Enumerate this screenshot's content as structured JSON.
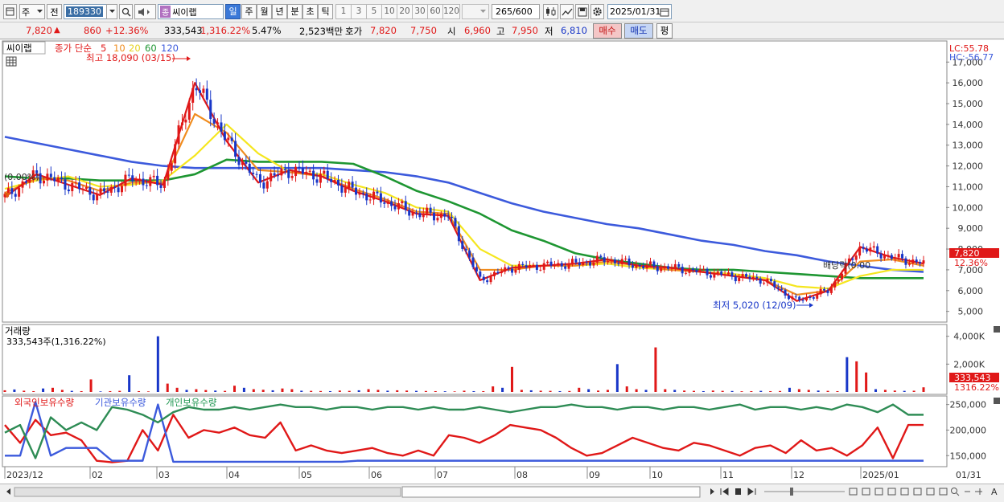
{
  "toolbar": {
    "market_label": "주",
    "prev_label": "전",
    "stock_code": "189330",
    "stock_name": "씨이랩",
    "stock_tag": "종",
    "periods": [
      "일",
      "주",
      "월",
      "년",
      "분",
      "초",
      "틱"
    ],
    "intervals": [
      "1",
      "3",
      "5",
      "10",
      "20",
      "30",
      "60",
      "120"
    ],
    "count": "265/600",
    "date": "2025/01/31"
  },
  "quote": {
    "price": "7,820",
    "change": "860",
    "change_pct": "+12.36%",
    "volume": "333,543",
    "volume_ratio": "1,316.22%",
    "turnover_pct": "5.47%",
    "amount": "2,523백만",
    "bid_label": "호가",
    "bid": "7,820",
    "ask": "7,750",
    "open_label": "시",
    "open": "6,960",
    "high_label": "고",
    "high": "7,950",
    "low_label": "저",
    "low": "6,810",
    "buy_label": "매수",
    "sell_label": "매도",
    "flat_label": "평"
  },
  "price_panel": {
    "stock_name": "씨이랩",
    "ma_legend": {
      "label": "종가 단순",
      "periods": [
        "5",
        "10",
        "20",
        "60",
        "120"
      ]
    },
    "high_note": "최고 18,090 (03/15)",
    "low_note": "최저 5,020 (12/09)",
    "left_note": "(0.00%)",
    "dividend_note": "배당락(0.00",
    "lc": "LC:55.78",
    "hc": "HC:-56.77",
    "last_price": "7,820",
    "last_pct": "12.36%",
    "y_ticks": [
      "17,000",
      "16,000",
      "15,000",
      "14,000",
      "13,000",
      "12,000",
      "11,000",
      "10,000",
      "9,000",
      "8,000",
      "7,000",
      "6,000",
      "5,000"
    ]
  },
  "volume_panel": {
    "title": "거래량",
    "info": "333,543주(1,316.22%)",
    "y_ticks": [
      "4,000K",
      "2,000K"
    ],
    "last_volume": "333,543",
    "last_ratio": "1316.22%"
  },
  "holding_panel": {
    "series": [
      "외국인보유수량",
      "기관보유수량",
      "개인보유수량"
    ],
    "y_ticks": [
      "250,000",
      "200,000",
      "150,000"
    ]
  },
  "x_axis": {
    "labels": [
      "2023/12",
      "02",
      "03",
      "04",
      "05",
      "06",
      "07",
      "08",
      "09",
      "10",
      "11",
      "12",
      "2025/01",
      "01/31"
    ]
  },
  "colors": {
    "ma5": "#e01818",
    "ma10": "#f08c1e",
    "ma20": "#f5e61e",
    "ma60": "#1e9632",
    "ma120": "#3c5adc",
    "up": "#e01818",
    "down": "#1836c8"
  },
  "chart_data": [
    {
      "type": "line",
      "title": "씨이랩",
      "y_unit": "KRW",
      "ylim": [
        4600,
        17900
      ],
      "x": [
        "2023/12",
        "02",
        "03",
        "04",
        "05",
        "06",
        "07",
        "08",
        "09",
        "10",
        "11",
        "12",
        "2025/01",
        "01/31"
      ],
      "series": [
        {
          "name": "5",
          "values": [
            10500,
            11600,
            11100,
            10600,
            11400,
            11100,
            16000,
            13200,
            11200,
            11800,
            11500,
            10800,
            10300,
            9700,
            9600,
            6500,
            7100,
            7200,
            7300,
            7500,
            7200,
            7100,
            6900,
            6700,
            6500,
            5500,
            6000,
            8100,
            7600,
            7300
          ]
        },
        {
          "name": "10",
          "values": [
            10700,
            11400,
            11300,
            10800,
            11200,
            11200,
            14500,
            13600,
            11800,
            11700,
            11500,
            10900,
            10400,
            9800,
            9700,
            7000,
            7000,
            7200,
            7200,
            7400,
            7200,
            7000,
            6900,
            6700,
            6500,
            5800,
            6000,
            7400,
            7500,
            7200
          ]
        },
        {
          "name": "20",
          "values": [
            10900,
            11300,
            11500,
            11000,
            11100,
            11300,
            12500,
            14000,
            12600,
            11700,
            11600,
            11100,
            10700,
            10000,
            9800,
            8000,
            7200,
            7200,
            7200,
            7300,
            7100,
            7000,
            6900,
            6800,
            6600,
            6200,
            6100,
            6700,
            7000,
            7000
          ]
        },
        {
          "name": "60",
          "values": [
            11500,
            11400,
            11400,
            11300,
            11300,
            11300,
            11600,
            12300,
            12200,
            12200,
            12200,
            12100,
            11500,
            10800,
            10300,
            9700,
            8900,
            8400,
            7800,
            7500,
            7300,
            7100,
            7000,
            7000,
            6900,
            6800,
            6700,
            6600,
            6600,
            6600
          ]
        },
        {
          "name": "120",
          "values": [
            13400,
            13100,
            12800,
            12500,
            12200,
            12000,
            11900,
            11900,
            11900,
            11900,
            11900,
            11800,
            11700,
            11500,
            11200,
            10700,
            10200,
            9800,
            9500,
            9200,
            9000,
            8700,
            8400,
            8200,
            7900,
            7700,
            7400,
            7200,
            7000,
            6900
          ]
        }
      ],
      "annotations": {
        "high": 18090,
        "high_date": "03/15",
        "low": 5020,
        "low_date": "12/09",
        "last": 7820
      }
    },
    {
      "type": "bar",
      "title": "거래량",
      "ylim": [
        0,
        4500
      ],
      "y_unit": "K shares",
      "values": [
        120,
        180,
        90,
        60,
        250,
        300,
        150,
        80,
        60,
        900,
        40,
        60,
        80,
        1200,
        60,
        40,
        4000,
        600,
        300,
        150,
        200,
        140,
        100,
        80,
        450,
        300,
        200,
        160,
        120,
        250,
        200,
        90,
        80,
        70,
        60,
        100,
        80,
        120,
        200,
        150,
        90,
        120,
        100,
        80,
        70,
        60,
        50,
        40,
        90,
        60,
        60,
        400,
        300,
        1800,
        150,
        120,
        90,
        80,
        60,
        70,
        300,
        200,
        100,
        150,
        2000,
        400,
        200,
        150,
        3200,
        200,
        150,
        100,
        80,
        60,
        100,
        80,
        70,
        50,
        60,
        80,
        60,
        70,
        300,
        200,
        150,
        100,
        80,
        60,
        2500,
        2200,
        1400,
        200,
        150,
        100,
        80,
        90,
        334
      ],
      "last": 333.543
    },
    {
      "type": "line",
      "ylim": [
        130000,
        262000
      ],
      "series": [
        {
          "name": "외국인보유수량",
          "values": [
            210000,
            175000,
            220000,
            190000,
            195000,
            180000,
            140000,
            137000,
            140000,
            200000,
            160000,
            230000,
            185000,
            200000,
            195000,
            205000,
            190000,
            185000,
            215000,
            160000,
            170000,
            160000,
            155000,
            160000,
            165000,
            155000,
            150000,
            160000,
            150000,
            190000,
            185000,
            175000,
            190000,
            210000,
            205000,
            200000,
            185000,
            165000,
            150000,
            155000,
            170000,
            185000,
            175000,
            165000,
            160000,
            175000,
            170000,
            160000,
            150000,
            165000,
            170000,
            155000,
            180000,
            160000,
            165000,
            150000,
            170000,
            205000,
            145000,
            210000,
            210000
          ]
        },
        {
          "name": "기관보유수량",
          "values": [
            150000,
            150000,
            255000,
            150000,
            165000,
            165000,
            165000,
            140000,
            140000,
            140000,
            250000,
            138000,
            138000,
            138000,
            138000,
            138000,
            138000,
            138000,
            138000,
            138000,
            138000,
            138000,
            138000,
            140000,
            140000,
            140000,
            140000,
            140000,
            140000,
            140000,
            140000,
            140000,
            140000,
            140000,
            140000,
            140000,
            140000,
            140000,
            140000,
            140000,
            140000,
            140000,
            140000,
            140000,
            140000,
            140000,
            140000,
            140000,
            140000,
            140000,
            140000,
            140000,
            140000,
            140000,
            140000,
            140000,
            140000,
            140000,
            140000,
            140000,
            140000
          ]
        },
        {
          "name": "개인보유수량",
          "values": [
            195000,
            210000,
            145000,
            225000,
            200000,
            215000,
            200000,
            245000,
            240000,
            230000,
            215000,
            235000,
            245000,
            240000,
            240000,
            245000,
            240000,
            245000,
            250000,
            245000,
            245000,
            240000,
            245000,
            245000,
            240000,
            245000,
            245000,
            240000,
            245000,
            240000,
            240000,
            245000,
            240000,
            235000,
            240000,
            245000,
            245000,
            250000,
            245000,
            245000,
            240000,
            245000,
            245000,
            240000,
            245000,
            245000,
            240000,
            245000,
            250000,
            240000,
            245000,
            245000,
            240000,
            245000,
            240000,
            250000,
            245000,
            235000,
            250000,
            230000,
            230000
          ]
        }
      ]
    }
  ]
}
